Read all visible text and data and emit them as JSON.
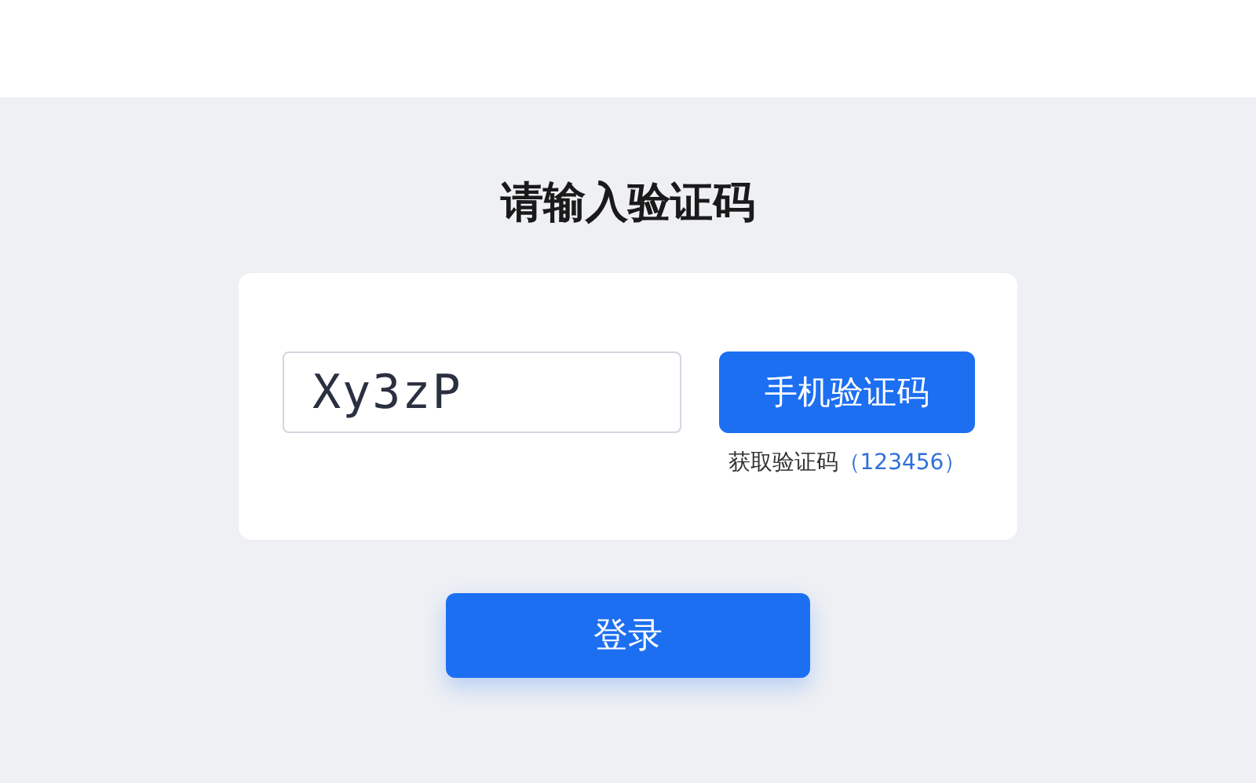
{
  "title": "请输入验证码",
  "captcha_field": {
    "value": "Xy3zP"
  },
  "sms_button": "手机验证码",
  "hint": {
    "label": "获取验证码",
    "code": "（123456）"
  },
  "login_button": "登录"
}
